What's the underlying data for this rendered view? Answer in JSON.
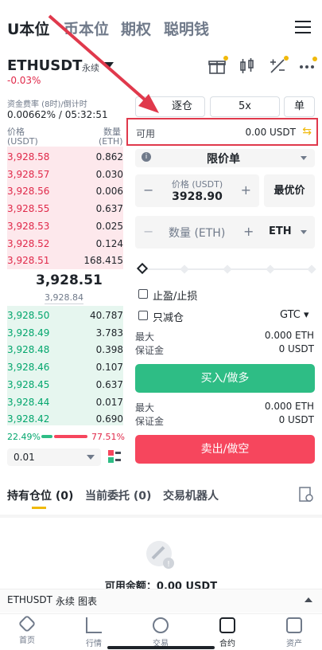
{
  "header": {
    "tabs": [
      "U本位",
      "币本位",
      "期权",
      "聪明钱"
    ]
  },
  "market": {
    "pair": "ETHUSDT",
    "type": "永续",
    "change": "-0.03%",
    "funding_label": "资金费率 (8时)/倒计时",
    "funding_value": "0.00662% / 05:32:51"
  },
  "orderbook": {
    "price_label": "价格",
    "price_unit": "(USDT)",
    "qty_label": "数量",
    "qty_unit": "(ETH)",
    "asks": [
      [
        "3,928.58",
        "0.862"
      ],
      [
        "3,928.57",
        "0.030"
      ],
      [
        "3,928.56",
        "0.006"
      ],
      [
        "3,928.55",
        "0.637"
      ],
      [
        "3,928.53",
        "0.025"
      ],
      [
        "3,928.52",
        "0.124"
      ],
      [
        "3,928.51",
        "168.415"
      ]
    ],
    "mid_price": "3,928.51",
    "mark_price": "3,928.84",
    "bids": [
      [
        "3,928.50",
        "40.787"
      ],
      [
        "3,928.49",
        "3.783"
      ],
      [
        "3,928.48",
        "0.398"
      ],
      [
        "3,928.46",
        "0.107"
      ],
      [
        "3,928.45",
        "0.637"
      ],
      [
        "3,928.44",
        "0.017"
      ],
      [
        "3,928.42",
        "0.690"
      ]
    ],
    "buy_pct": "22.49%",
    "sell_pct": "77.51%",
    "depth": "0.01"
  },
  "form": {
    "margin_mode": "逐仓",
    "leverage": "5x",
    "mode": "单",
    "avail_label": "可用",
    "avail_value": "0.00 USDT",
    "order_type": "限价单",
    "price_label": "价格 (USDT)",
    "price_value": "3928.90",
    "best_price": "最优价",
    "qty_placeholder": "数量 (ETH)",
    "qty_unit": "ETH",
    "tpsl": "止盈/止损",
    "reduce_only": "只减仓",
    "tif": "GTC",
    "buy": {
      "max_label": "最大",
      "max_value": "0.000 ETH",
      "margin_label": "保证金",
      "margin_value": "0 USDT",
      "button": "买入/做多"
    },
    "sell": {
      "max_label": "最大",
      "max_value": "0.000 ETH",
      "margin_label": "保证金",
      "margin_value": "0 USDT",
      "button": "卖出/做空"
    }
  },
  "positions": {
    "tabs": [
      "持有仓位 (0)",
      "当前委托 (0)",
      "交易机器人"
    ],
    "available": "可用余额：0.00 USDT"
  },
  "bottom_bar": {
    "pair": "ETHUSDT",
    "type": "永续",
    "chart": "图表"
  },
  "nav": [
    "首页",
    "行情",
    "交易",
    "合约",
    "资产"
  ],
  "colors": {
    "green": "#2ebd85",
    "red": "#f6465d",
    "accent": "#f0b90b",
    "highlight": "#e0394c"
  }
}
